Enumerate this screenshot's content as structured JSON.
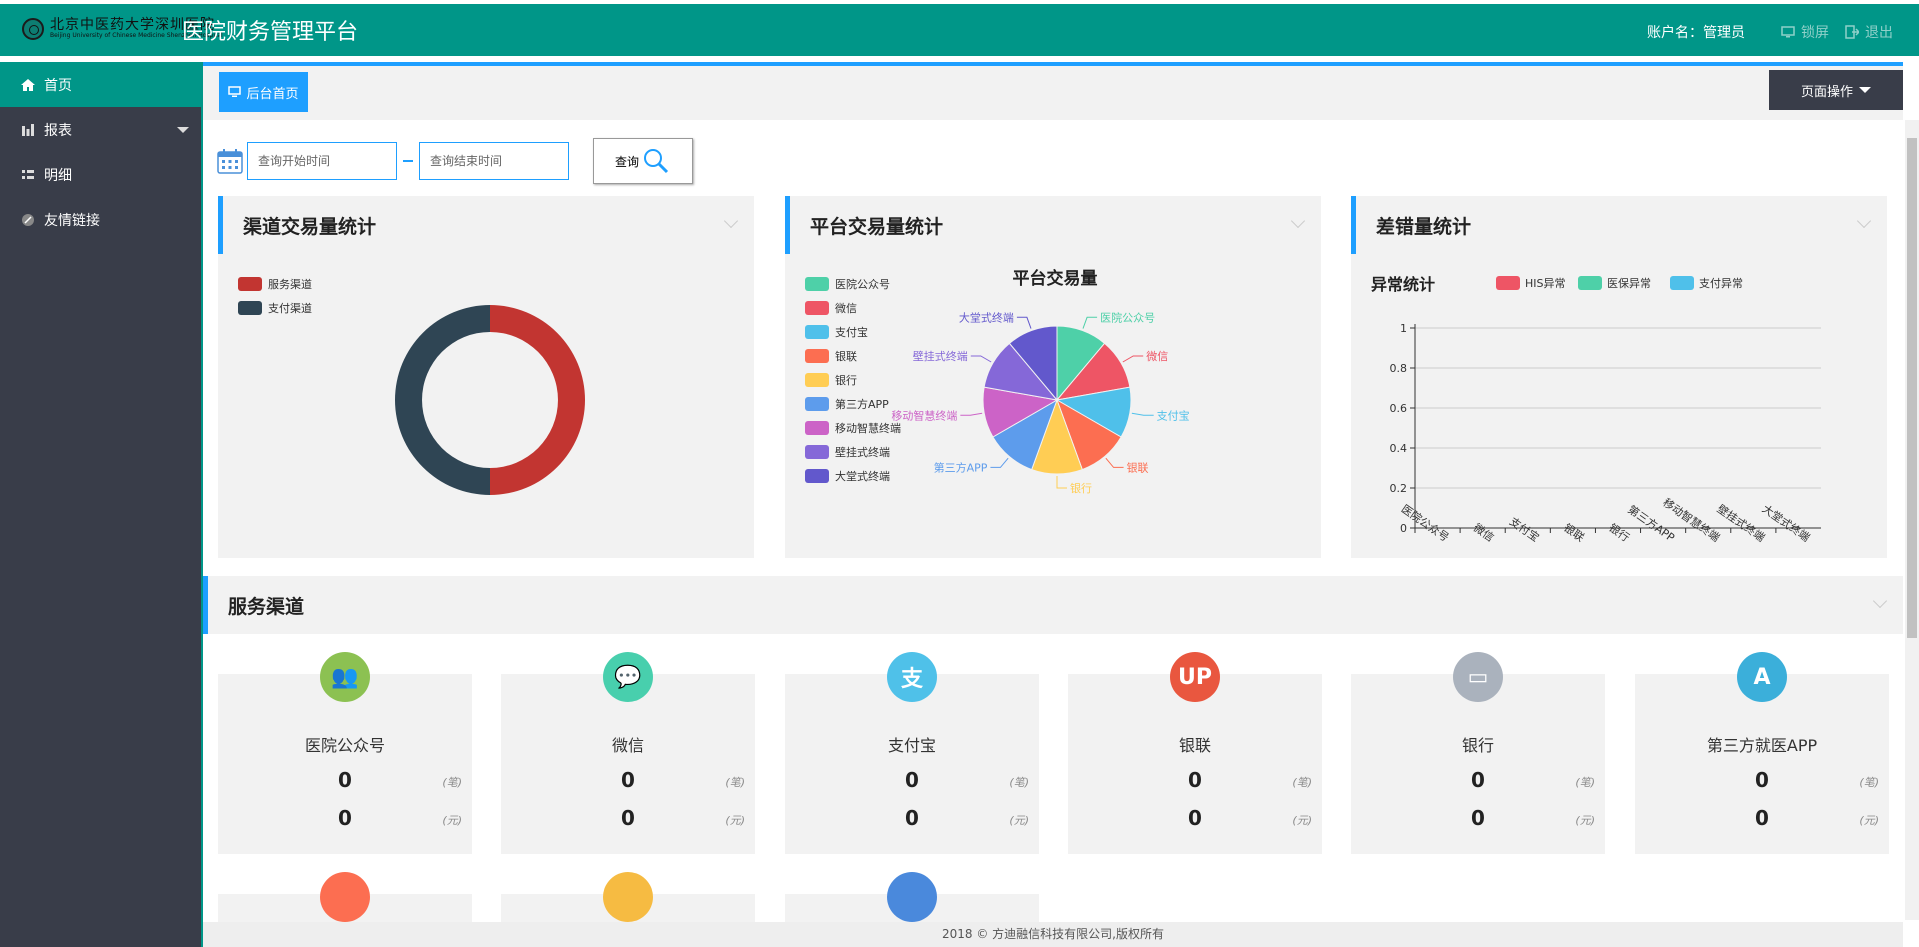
{
  "header": {
    "logo_cn": "北京中医药大学深圳医院",
    "logo_en": "Beijing University of Chinese Medicine Shenzhen Hospital",
    "title": "医院财务管理平台",
    "account": "账户名：管理员",
    "lock_label": "锁屏",
    "logout_label": "退出",
    "brand_color": "#009688"
  },
  "sidebar": {
    "items": [
      {
        "label": "首页",
        "icon": "home-icon",
        "active": true
      },
      {
        "label": "报表",
        "icon": "bar-chart-icon",
        "active": false
      },
      {
        "label": "明细",
        "icon": "list-icon",
        "active": false
      },
      {
        "label": "友情链接",
        "icon": "link-icon",
        "active": false
      }
    ]
  },
  "tabs": {
    "home_label": "后台首页",
    "page_ops_label": "页面操作"
  },
  "search": {
    "start_placeholder": "查询开始时间",
    "end_placeholder": "查询结束时间",
    "query_label": "查询"
  },
  "panels": {
    "channel": {
      "title": "渠道交易量统计"
    },
    "platform": {
      "title": "平台交易量统计"
    },
    "errors": {
      "title": "差错量统计"
    }
  },
  "chart_data": [
    {
      "type": "pie",
      "variant": "donut",
      "legend": [
        "服务渠道",
        "支付渠道"
      ],
      "values": [
        50,
        50
      ],
      "colors": [
        "#c23531",
        "#2f4554"
      ]
    },
    {
      "type": "pie",
      "title": "平台交易量",
      "legend": [
        "医院公众号",
        "微信",
        "支付宝",
        "银联",
        "银行",
        "第三方APP",
        "移动智慧终端",
        "壁挂式终端",
        "大堂式终端"
      ],
      "values": [
        1,
        1,
        1,
        1,
        1,
        1,
        1,
        1,
        1
      ],
      "colors": [
        "#4ed0a8",
        "#ee5565",
        "#4fc0ea",
        "#fc6e51",
        "#ffcd54",
        "#5d9cec",
        "#cc63c7",
        "#8568d8",
        "#6258cc"
      ]
    },
    {
      "type": "bar",
      "title": "异常统计",
      "series": [
        {
          "name": "HIS异常",
          "color": "#ee5565",
          "values": [
            0,
            0,
            0,
            0,
            0,
            0,
            0,
            0,
            0
          ]
        },
        {
          "name": "医保异常",
          "color": "#4ed0a8",
          "values": [
            0,
            0,
            0,
            0,
            0,
            0,
            0,
            0,
            0
          ]
        },
        {
          "name": "支付异常",
          "color": "#4fc0ea",
          "values": [
            0,
            0,
            0,
            0,
            0,
            0,
            0,
            0,
            0
          ]
        }
      ],
      "categories": [
        "医院公众号",
        "微信",
        "支付宝",
        "银联",
        "银行",
        "第三方APP",
        "移动智慧终端",
        "壁挂式终端",
        "大堂式终端"
      ],
      "yticks": [
        "0",
        "0.2",
        "0.4",
        "0.6",
        "0.8",
        "1"
      ],
      "ylim": [
        0,
        1
      ],
      "grid": true
    }
  ],
  "service": {
    "title": "服务渠道",
    "count_unit": "(笔)",
    "amount_unit": "(元)",
    "cards": [
      {
        "name": "医院公众号",
        "count": "0",
        "amount": "0",
        "icon": "users-icon",
        "color": "#8cc152"
      },
      {
        "name": "微信",
        "count": "0",
        "amount": "0",
        "icon": "wechat-icon",
        "color": "#48cfad"
      },
      {
        "name": "支付宝",
        "count": "0",
        "amount": "0",
        "icon": "alipay-icon",
        "color": "#4fc1e9"
      },
      {
        "name": "银联",
        "count": "0",
        "amount": "0",
        "icon": "unionpay-icon",
        "color": "#e9573f"
      },
      {
        "name": "银行",
        "count": "0",
        "amount": "0",
        "icon": "bank-card-icon",
        "color": "#aab2bd"
      },
      {
        "name": "第三方就医APP",
        "count": "0",
        "amount": "0",
        "icon": "app-store-icon",
        "color": "#3bafda"
      }
    ],
    "partial_cards": [
      {
        "icon": "pos-terminal-icon",
        "color": "#fc6e51"
      },
      {
        "icon": "screen-icon",
        "color": "#f6bb42"
      },
      {
        "icon": "kiosk-icon",
        "color": "#4a89dc"
      }
    ]
  },
  "footer": {
    "text": "2018 © 方迪融信科技有限公司,版权所有"
  }
}
